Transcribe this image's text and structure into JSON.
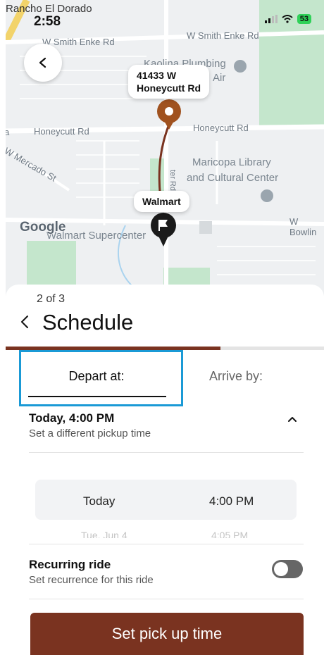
{
  "status_bar": {
    "time": "2:58",
    "place": "Rancho El Dorado",
    "battery": "53"
  },
  "map": {
    "labels": {
      "smith_enke_left": "W Smith Enke Rd",
      "smith_enke_right": "W Smith Enke Rd",
      "honeycutt_left": "Honeycutt Rd",
      "honeycutt_right": "Honeycutt Rd",
      "mercado": "W Mercado St",
      "ter_rd": "ter Rd",
      "kaolina": "Kaolina Plumbing",
      "kaolina2": "Air",
      "library_line1": "Maricopa Library",
      "library_line2": "and Cultural Center",
      "bowlin": "W Bowlin",
      "walmart_super": "Walmart Supercenter",
      "google": "Google",
      "partial_a": "a"
    },
    "pickup_callout_line1": "41433 W",
    "pickup_callout_line2": "Honeycutt Rd",
    "dropoff_callout": "Walmart",
    "colors": {
      "route": "#7a3320",
      "pin_pickup": "#a0521f",
      "pin_dropoff": "#1b1b1b",
      "park": "#bfe3c9"
    }
  },
  "sheet": {
    "step": "2 of 3",
    "title": "Schedule",
    "progress": 0.67,
    "tabs": {
      "depart": "Depart at:",
      "arrive": "Arrive by:"
    },
    "pickup": {
      "time": "Today, 4:00 PM",
      "subtitle": "Set a different pickup time"
    },
    "picker": {
      "selected_day": "Today",
      "selected_time": "4:00 PM",
      "next_day": "Tue, Jun 4",
      "next_time": "4:05 PM"
    },
    "recurring": {
      "title": "Recurring ride",
      "subtitle": "Set recurrence for this ride",
      "enabled": false
    },
    "cta": "Set pick up time"
  },
  "icons": {
    "back_map": "chevron-left-icon",
    "back_sheet": "chevron-left-icon",
    "expand": "chevron-up-icon"
  }
}
